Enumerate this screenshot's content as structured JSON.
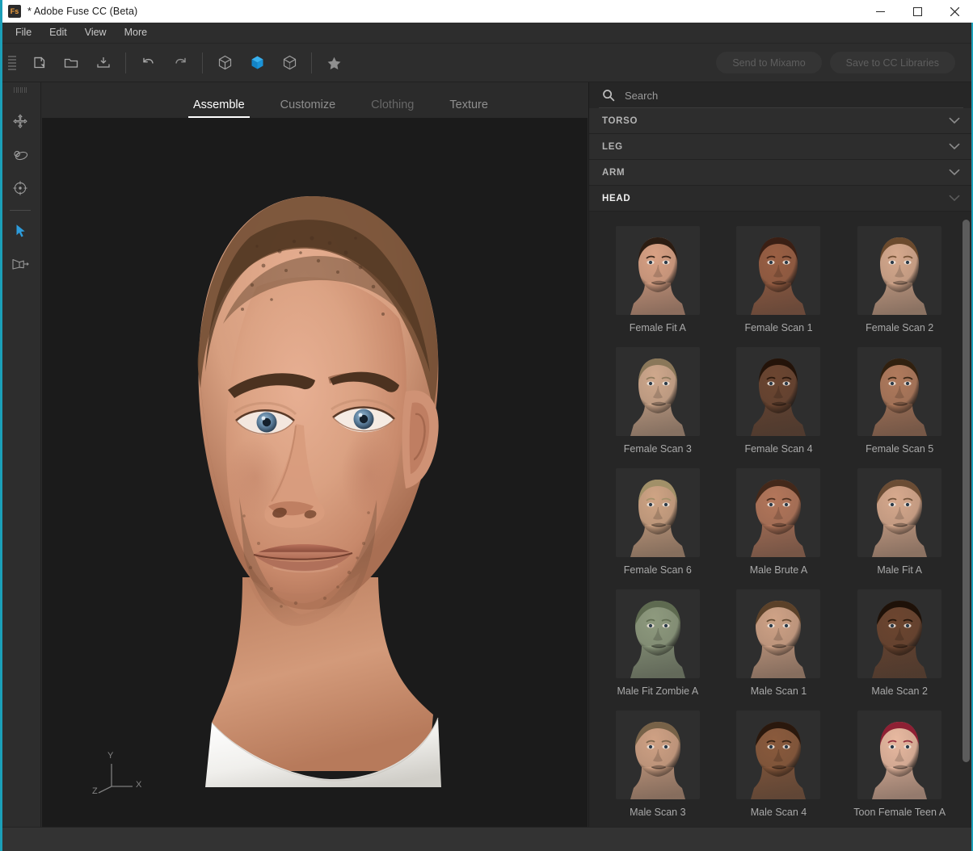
{
  "window": {
    "title": "* Adobe Fuse CC (Beta)",
    "app_badge": "Fs",
    "minimize_label": "—",
    "maximize_label": "□",
    "close_label": "✕"
  },
  "menubar": {
    "items": [
      {
        "label": "File"
      },
      {
        "label": "Edit"
      },
      {
        "label": "View"
      },
      {
        "label": "More"
      }
    ]
  },
  "toolbar": {
    "buttons": [
      {
        "name": "new-document-icon",
        "tooltip": "New"
      },
      {
        "name": "open-folder-icon",
        "tooltip": "Open"
      },
      {
        "name": "save-icon",
        "tooltip": "Save"
      },
      {
        "name": "undo-icon",
        "tooltip": "Undo"
      },
      {
        "name": "redo-icon",
        "tooltip": "Redo"
      },
      {
        "name": "cube-wireframe-icon",
        "tooltip": "Wireframe"
      },
      {
        "name": "cube-solid-icon",
        "tooltip": "Solid"
      },
      {
        "name": "cube-shaded-icon",
        "tooltip": "Shaded"
      },
      {
        "name": "star-icon",
        "tooltip": "Favorites"
      }
    ],
    "send_to_mixamo_label": "Send to Mixamo",
    "save_to_cc_label": "Save to CC Libraries"
  },
  "tool_rail": {
    "items": [
      {
        "name": "pan-tool",
        "label": "Pan"
      },
      {
        "name": "orbit-tool",
        "label": "Orbit"
      },
      {
        "name": "focus-tool",
        "label": "Focus"
      },
      {
        "name": "select-tool",
        "label": "Select"
      },
      {
        "name": "transform-tool",
        "label": "Transform"
      }
    ]
  },
  "tabs": [
    {
      "label": "Assemble",
      "state": "active"
    },
    {
      "label": "Customize",
      "state": "normal"
    },
    {
      "label": "Clothing",
      "state": "disabled"
    },
    {
      "label": "Texture",
      "state": "normal"
    }
  ],
  "viewport": {
    "axis": {
      "x": "X",
      "y": "Y",
      "z": "Z"
    }
  },
  "search": {
    "placeholder": "Search",
    "value": ""
  },
  "sections": [
    {
      "label": "TORSO",
      "expanded": false
    },
    {
      "label": "LEG",
      "expanded": false
    },
    {
      "label": "ARM",
      "expanded": false
    },
    {
      "label": "HEAD",
      "expanded": true
    }
  ],
  "head_items": [
    {
      "label": "Female Fit A",
      "skin": "#d9a184",
      "hair": "#2b1c12",
      "gender": "female"
    },
    {
      "label": "Female Scan 1",
      "skin": "#9a5f43",
      "hair": "#3a1f14",
      "gender": "female"
    },
    {
      "label": "Female Scan 2",
      "skin": "#d6a98d",
      "hair": "#6b4a2d",
      "gender": "female"
    },
    {
      "label": "Female Scan 3",
      "skin": "#cfa88c",
      "hair": "#8a7759",
      "gender": "female"
    },
    {
      "label": "Female Scan 4",
      "skin": "#6b4530",
      "hair": "#231309",
      "gender": "female"
    },
    {
      "label": "Female Scan 5",
      "skin": "#b07a5c",
      "hair": "#30200f",
      "gender": "female"
    },
    {
      "label": "Female Scan 6",
      "skin": "#cfa484",
      "hair": "#a19068",
      "gender": "female"
    },
    {
      "label": "Male Brute A",
      "skin": "#b3765a",
      "hair": "#43281a",
      "gender": "male"
    },
    {
      "label": "Male Fit A",
      "skin": "#d7a98d",
      "hair": "#6a4c34",
      "gender": "male"
    },
    {
      "label": "Male Fit Zombie A",
      "skin": "#8e9a7e",
      "hair": "#5e6a50",
      "gender": "male"
    },
    {
      "label": "Male Scan 1",
      "skin": "#cfa286",
      "hair": "#5b4129",
      "gender": "male"
    },
    {
      "label": "Male Scan 2",
      "skin": "#6c452f",
      "hair": "#1e1108",
      "gender": "male"
    },
    {
      "label": "Male Scan 3",
      "skin": "#cfa184",
      "hair": "#776248",
      "gender": "male"
    },
    {
      "label": "Male Scan 4",
      "skin": "#8a5a3c",
      "hair": "#2a180d",
      "gender": "male"
    },
    {
      "label": "Toon Female Teen A",
      "skin": "#e8b9a0",
      "hair": "#8e2034",
      "gender": "female"
    }
  ],
  "colors": {
    "accent_teal": "#1b9fb8",
    "accent_blue": "#2d9cdb",
    "panel_bg": "#262626",
    "toolbar_bg": "#2d2d2d",
    "viewport_bg": "#1b1b1b"
  }
}
